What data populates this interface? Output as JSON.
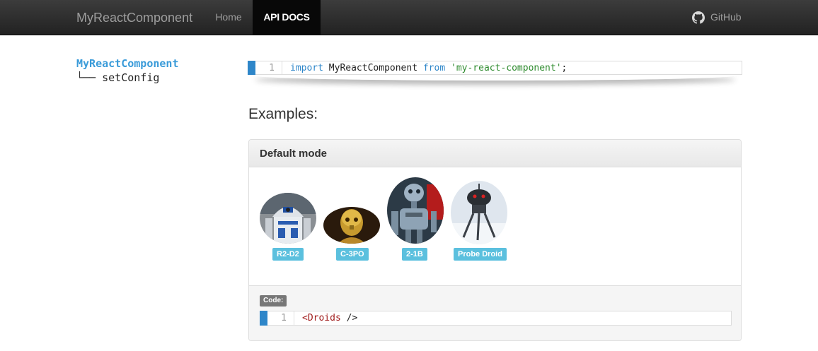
{
  "navbar": {
    "brand": "MyReactComponent",
    "items": [
      {
        "label": "Home",
        "active": false
      },
      {
        "label": "API DOCS",
        "active": true
      }
    ],
    "github": {
      "label": "GitHub",
      "icon": "github-icon"
    }
  },
  "sidebar": {
    "root": "MyReactComponent",
    "children": [
      {
        "branch": "└──",
        "label": "setConfig"
      }
    ]
  },
  "import_code": {
    "line_number": "1",
    "keyword_import": "import",
    "identifier": "MyReactComponent",
    "keyword_from": "from",
    "string": "'my-react-component'",
    "terminator": ";"
  },
  "examples_heading": "Examples:",
  "panel": {
    "title": "Default mode",
    "droids": [
      {
        "name": "R2-D2",
        "icon": "r2d2-image"
      },
      {
        "name": "C-3PO",
        "icon": "c3po-image"
      },
      {
        "name": "2-1B",
        "icon": "2-1b-image"
      },
      {
        "name": "Probe Droid",
        "icon": "probe-droid-image"
      }
    ],
    "code_label": "Code:",
    "code": {
      "line_number": "1",
      "tag_open": "<Droids",
      "tag_close": " />"
    }
  },
  "colors": {
    "navbar_active_bg": "#080808",
    "link_blue": "#3a9bd9",
    "badge_info": "#5bc0de",
    "code_marker": "#2e86c9",
    "string_green": "#2e8b2e",
    "tag_red": "#a01b1b"
  }
}
